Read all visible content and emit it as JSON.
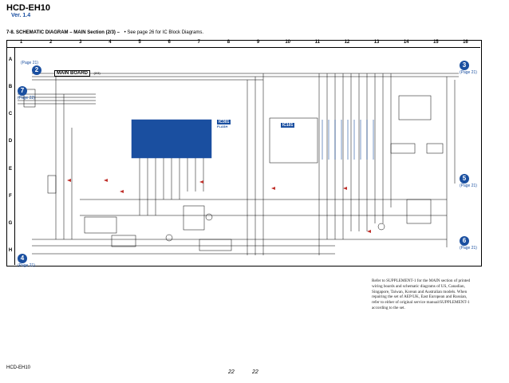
{
  "header": {
    "model": "HCD-EH10",
    "version": "Ver. 1.4",
    "section_title": "7-8.  SCHEMATIC  DIAGRAM  – MAIN Section (2/3) –",
    "section_note": "• See page 26 for IC Block Diagrams."
  },
  "grid": {
    "columns": [
      "1",
      "2",
      "3",
      "4",
      "5",
      "6",
      "7",
      "8",
      "9",
      "10",
      "11",
      "12",
      "13",
      "14",
      "15",
      "16"
    ],
    "rows": [
      "A",
      "B",
      "C",
      "D",
      "E",
      "F",
      "G",
      "H"
    ]
  },
  "board_label": "MAIN BOARD",
  "board_suffix": "(2/3)",
  "ic_labels": [
    {
      "name": "IC301",
      "sub": "FLASH"
    },
    {
      "name": "IC101",
      "sub": ""
    }
  ],
  "connectors": [
    {
      "num": "2",
      "page": "(Page 21)"
    },
    {
      "num": "7",
      "page": "(Page 22)"
    },
    {
      "num": "3",
      "page": "(Page 21)"
    },
    {
      "num": "5",
      "page": "(Page 21)"
    },
    {
      "num": "6",
      "page": "(Page 21)"
    },
    {
      "num": "4",
      "page": "(Page 21)"
    }
  ],
  "supplement_note": "Refer to SUPPLEMENT-1 for the MAIN section of printed wiring boards and schematic diagrams of US, Canadian, Singapore, Taiwan, Korean and Australian models. When repairing the set of AEP/UK, East European and Russian, refer to either of original service manual/SUPPLEMENT-1 according to the set.",
  "footer": {
    "model": "HCD-EH10",
    "page_left": "22",
    "page_right": "22"
  },
  "colors": {
    "accent_blue": "#1a4fa0",
    "ic_body": "#1a4fa0",
    "wire": "#000000"
  }
}
